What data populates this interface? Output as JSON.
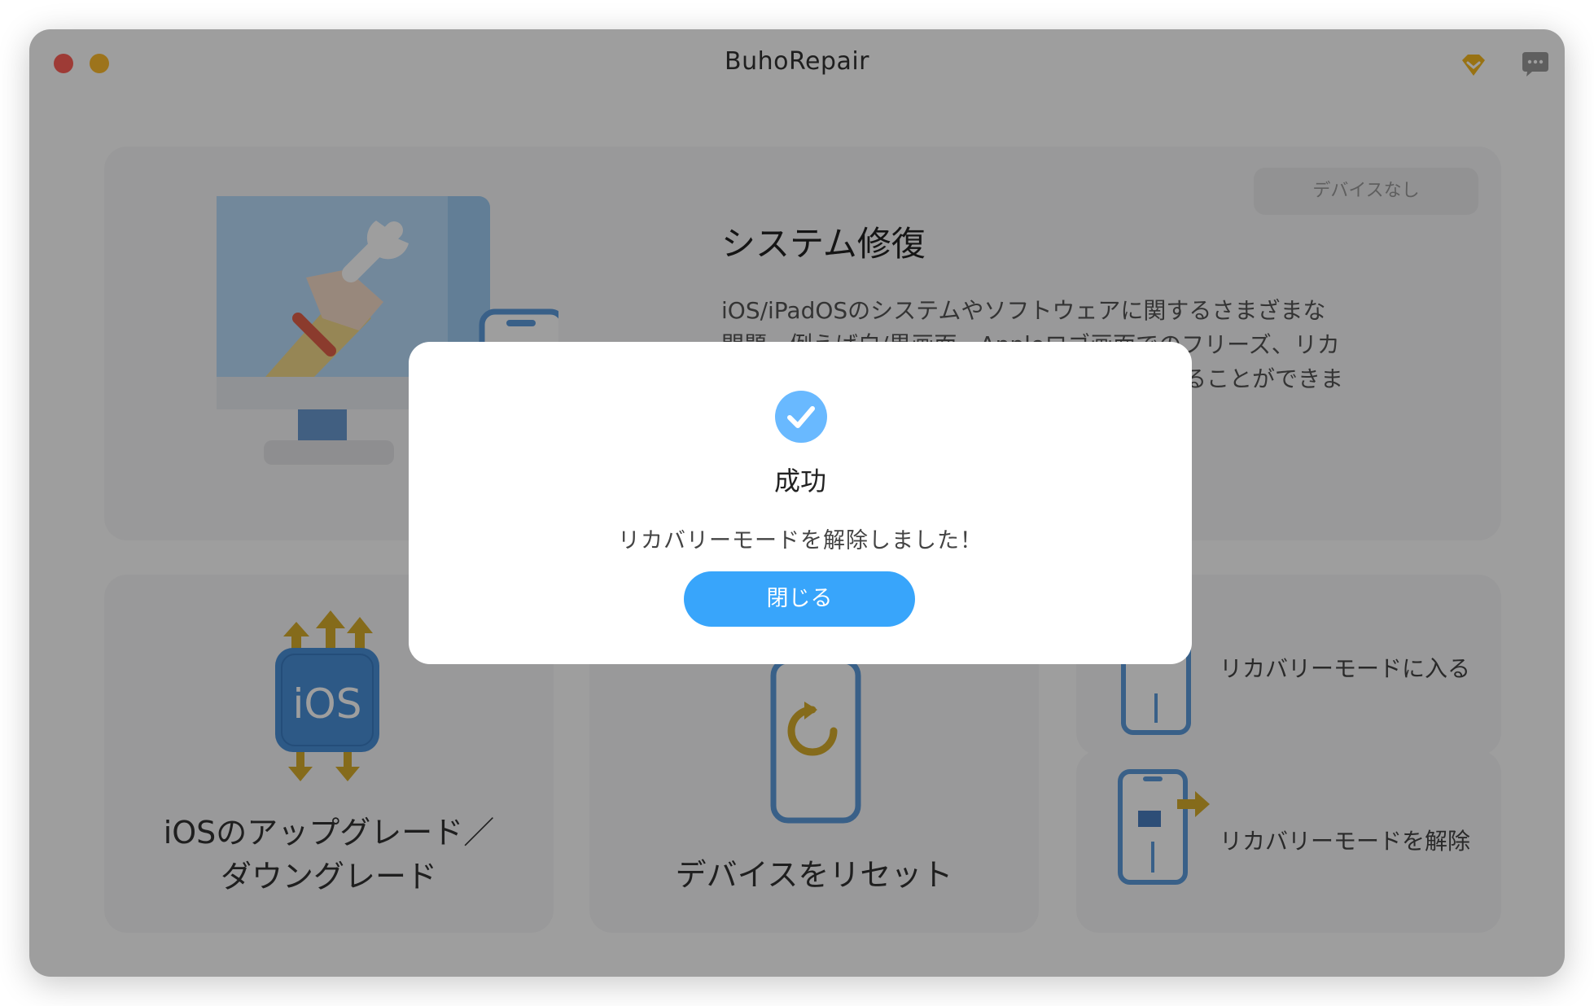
{
  "window": {
    "title": "BuhoRepair"
  },
  "hero": {
    "title": "システム修復",
    "description_lines": [
      "iOS/iPadOSのシステムやソフトウェアに関するさまざまな",
      "問題、例えば白/黒画面、Appleロゴ画面でのフリーズ、リカ",
      "…ることができま"
    ],
    "status_badge": "デバイスなし"
  },
  "cards": {
    "upgrade": {
      "label_line1": "iOSのアップグレード／",
      "label_line2": "ダウングレード",
      "icon_text": "iOS"
    },
    "reset": {
      "label": "デバイスをリセット"
    },
    "enter_recovery": {
      "label": "リカバリーモードに入る"
    },
    "exit_recovery": {
      "label": "リカバリーモードを解除"
    }
  },
  "modal": {
    "title": "成功",
    "message": "リカバリーモードを解除しました！",
    "close_label": "閉じる"
  },
  "icons": {
    "premium": "diamond-icon",
    "feedback": "chat-bubble-icon",
    "success": "check-circle-icon"
  },
  "colors": {
    "accent": "#38a5fb",
    "gold": "#d7ad2c",
    "icon_blue": "#4a90d9",
    "close_dot": "#ff5f57",
    "minimize_dot": "#febc2e"
  }
}
